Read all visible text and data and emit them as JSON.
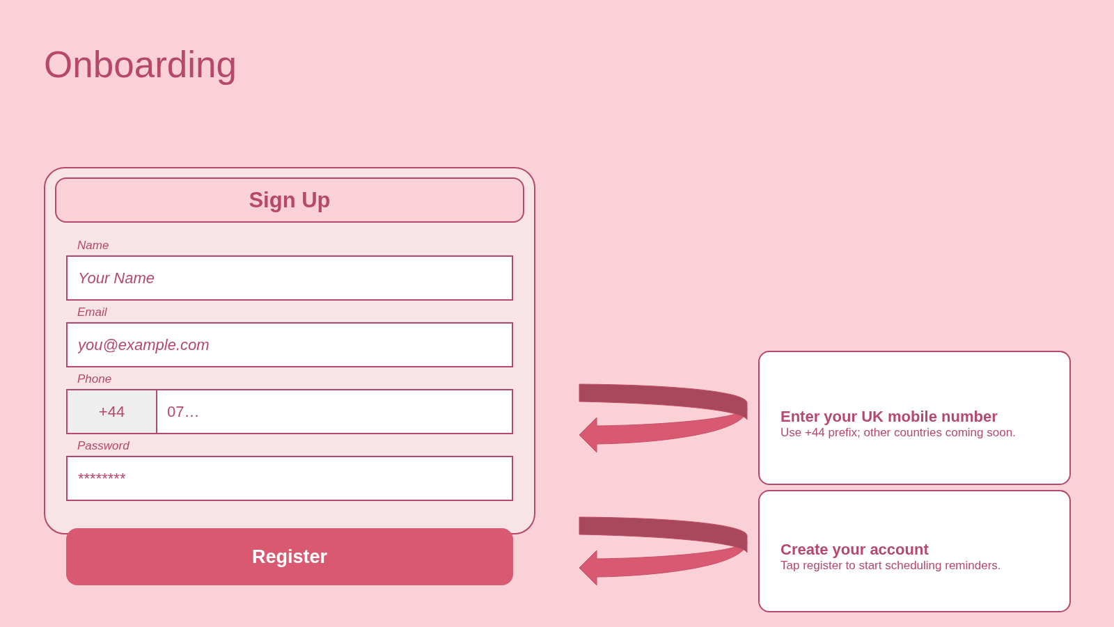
{
  "page": {
    "title": "Onboarding"
  },
  "form": {
    "title": "Sign Up",
    "fields": [
      {
        "kind": "text",
        "label": "Name",
        "placeholder": "Your Name"
      },
      {
        "kind": "text",
        "label": "Email",
        "placeholder": "you@example.com"
      },
      {
        "kind": "phone",
        "label": "Phone",
        "prefix": "+44",
        "placeholder": "07…"
      },
      {
        "kind": "password",
        "label": "Password",
        "placeholder": "********"
      }
    ],
    "submit_button": "Register"
  },
  "callouts": [
    {
      "title": "Enter your UK mobile number",
      "text": "Use +44 prefix; other countries coming soon."
    },
    {
      "title": "Create your account",
      "text": "Tap register to start scheduling reminders."
    }
  ]
}
